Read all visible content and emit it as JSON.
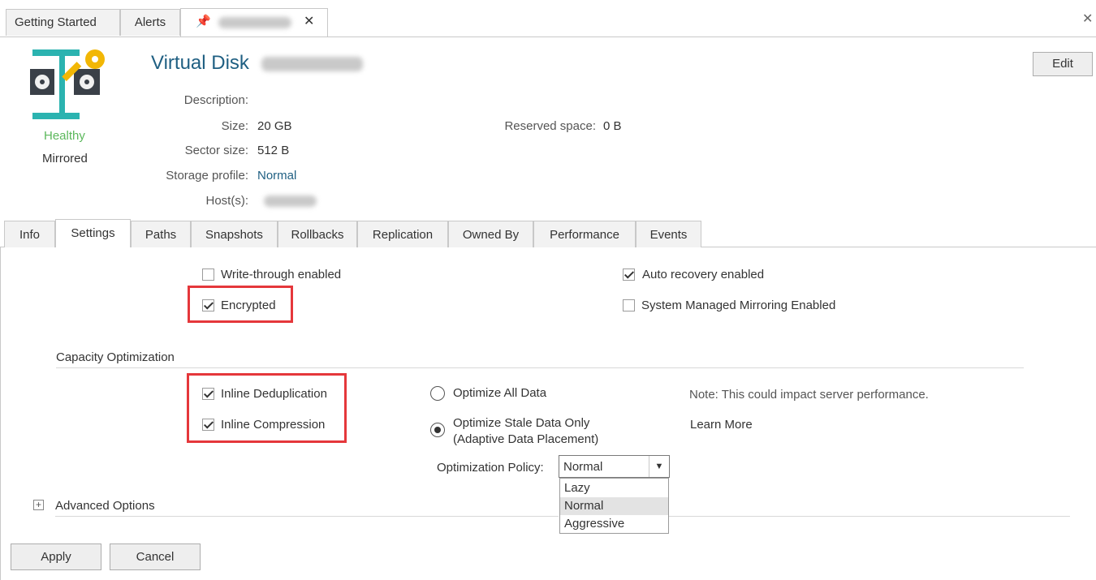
{
  "doc_tabs": [
    {
      "label": "Getting Started"
    },
    {
      "label": "Alerts"
    }
  ],
  "disk": {
    "title": "Virtual Disk",
    "status": "Healthy",
    "mode": "Mirrored",
    "edit_label": "Edit"
  },
  "properties": {
    "description_label": "Description:",
    "size_label": "Size:",
    "size_value": "20 GB",
    "reserved_label": "Reserved space:",
    "reserved_value": "0 B",
    "sector_label": "Sector size:",
    "sector_value": "512 B",
    "profile_label": "Storage profile:",
    "profile_value": "Normal",
    "hosts_label": "Host(s):"
  },
  "settings_tabs": [
    "Info",
    "Settings",
    "Paths",
    "Snapshots",
    "Rollbacks",
    "Replication",
    "Owned By",
    "Performance",
    "Events"
  ],
  "settings": {
    "write_through": {
      "label": "Write-through enabled",
      "checked": false
    },
    "encrypted": {
      "label": "Encrypted",
      "checked": true
    },
    "auto_recovery": {
      "label": "Auto recovery enabled",
      "checked": true
    },
    "system_mirroring": {
      "label": "System Managed Mirroring Enabled",
      "checked": false
    }
  },
  "capacity": {
    "heading": "Capacity Optimization",
    "dedup": {
      "label": "Inline Deduplication",
      "checked": true
    },
    "compression": {
      "label": "Inline Compression",
      "checked": true
    },
    "opt_all": "Optimize All Data",
    "opt_stale_line1": "Optimize Stale Data Only",
    "opt_stale_line2": "(Adaptive Data Placement)",
    "note": "Note: This could impact server performance.",
    "learn_more": "Learn More",
    "policy_label": "Optimization Policy:",
    "policy_value": "Normal",
    "policy_options": [
      "Lazy",
      "Normal",
      "Aggressive"
    ]
  },
  "advanced_label": "Advanced Options",
  "buttons": {
    "apply": "Apply",
    "cancel": "Cancel"
  },
  "colors": {
    "accent": "#1f5f82",
    "healthy": "#5cb85c",
    "highlight": "#e5373b",
    "disk_icon": "#2bb3b0",
    "key": "#f2b705"
  }
}
